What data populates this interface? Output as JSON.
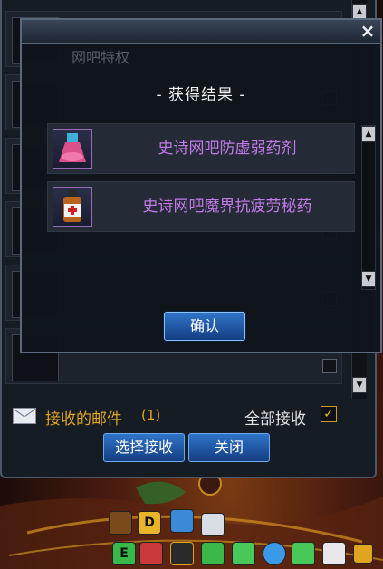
{
  "mailbox": {
    "received_label": "接收的邮件",
    "received_count": "(1)",
    "accept_all_label": "全部接收",
    "accept_all_checked": "✓",
    "select_receive_button": "选择接收",
    "close_button": "关闭",
    "scroll_up": "▲",
    "scroll_down": "▼"
  },
  "dialog": {
    "faded_title": "网吧特权",
    "close_icon": "×",
    "heading": "- 获得结果 -",
    "items": [
      {
        "name": "史诗网吧防虚弱药剂",
        "icon": "potion-flask-icon"
      },
      {
        "name": "史诗网吧魔界抗疲劳秘药",
        "icon": "medicine-bottle-icon"
      }
    ],
    "confirm_button": "确认",
    "scroll_up": "▲",
    "scroll_down": "▼"
  },
  "hud": {
    "icons": [
      "treasure-chest-icon",
      "d-badge-icon",
      "monitor-icon",
      "mail-icon",
      "e-badge-icon",
      "character-icon",
      "tv-icon",
      "gift-icon",
      "ticket-icon",
      "tp-icon",
      "ticket-icon",
      "avatar-icon",
      "crown-icon"
    ]
  },
  "colors": {
    "accent_gold": "#e0a41e",
    "item_purple": "#c27ae8",
    "button_blue": "#2f74c8"
  }
}
